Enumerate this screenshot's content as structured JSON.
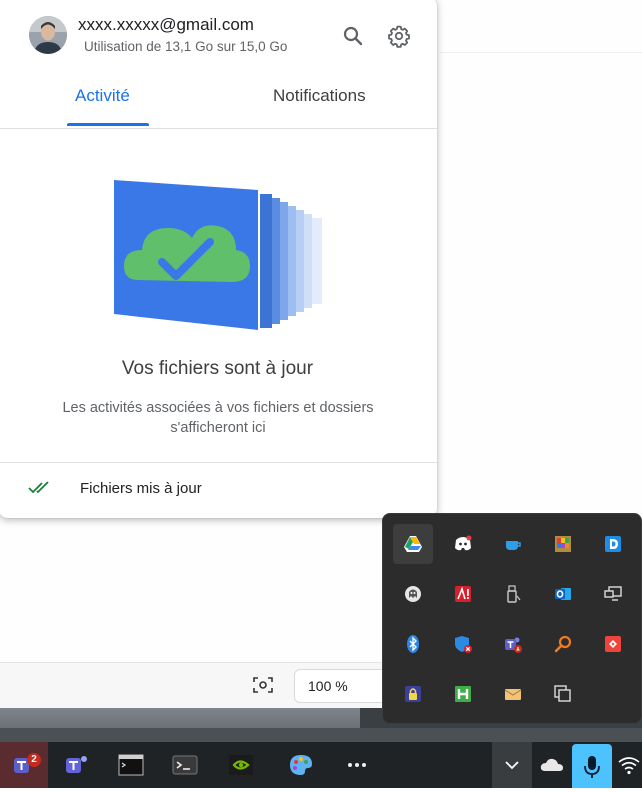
{
  "account": {
    "email": "xxxx.xxxxx@gmail.com",
    "usage": "Utilisation de 13,1 Go sur 15,0 Go"
  },
  "tabs": [
    {
      "label": "Activité",
      "active": true
    },
    {
      "label": "Notifications",
      "active": false
    }
  ],
  "empty_state": {
    "title": "Vos fichiers sont à jour",
    "description": "Les activités associées à vos fichiers et dossiers s'afficheront ici"
  },
  "footer": {
    "status": "Fichiers mis à jour"
  },
  "viewer": {
    "zoom": "100 %"
  },
  "tray_icons": [
    "google-drive-icon",
    "discord-icon",
    "coffee-cup-icon",
    "color-palette-app-icon",
    "d-app-icon",
    "ghost-app-icon",
    "red-alert-app-icon",
    "usb-drive-icon",
    "outlook-icon",
    "remote-desktop-icon",
    "bluetooth-icon",
    "defender-warning-icon",
    "teams-notification-icon",
    "orange-search-icon",
    "anydesk-icon",
    "vpn-lock-icon",
    "h-app-icon",
    "mail-icon",
    "copy-windows-icon"
  ],
  "taskbar": {
    "teams_badge": "2",
    "items": [
      "teams-classic-icon",
      "teams-new-icon",
      "terminal-icon",
      "terminal-dark-icon",
      "nvidia-icon",
      "paint-icon",
      "more-icon"
    ],
    "tray": [
      "chevron-up-icon",
      "onedrive-icon",
      "microphone-icon",
      "wifi-icon"
    ]
  },
  "colors": {
    "accent": "#1a73e8",
    "success": "#188038",
    "tray_bg": "#2c2c2c",
    "taskbar_bg": "#202326"
  }
}
